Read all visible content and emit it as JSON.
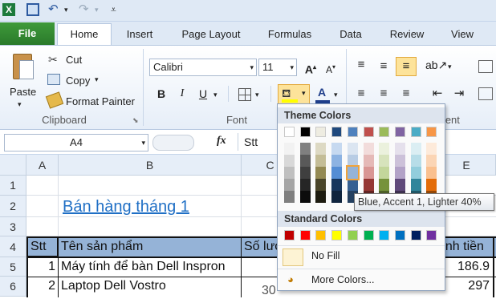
{
  "qat": {
    "app_icon": "excel-icon",
    "icons": [
      "save-icon",
      "undo-icon",
      "redo-icon",
      "customize-qat-icon"
    ]
  },
  "tabs": [
    "File",
    "Home",
    "Insert",
    "Page Layout",
    "Formulas",
    "Data",
    "Review",
    "View"
  ],
  "clipboard": {
    "paste": "Paste",
    "cut": "Cut",
    "copy": "Copy",
    "format_painter": "Format Painter",
    "group": "Clipboard"
  },
  "font": {
    "name": "Calibri",
    "size": "11",
    "group": "Font",
    "bold": "B",
    "italic": "I",
    "underline": "U"
  },
  "alignment": {
    "group": "Alignment"
  },
  "formula_bar": {
    "name_box": "A4",
    "fx": "fx",
    "value": "Stt"
  },
  "columns": [
    "A",
    "B",
    "C",
    "D",
    "E"
  ],
  "rows": [
    "1",
    "2",
    "3",
    "4",
    "5",
    "6"
  ],
  "sheet": {
    "title": "Bán hàng tháng 1",
    "header": {
      "stt": "Stt",
      "product": "Tên sản phẩm",
      "qty": "Số lượ",
      "total": "ành tiền"
    },
    "rows": [
      {
        "stt": "1",
        "product": "Máy tính để bàn Dell Inspron",
        "total": "186.9"
      },
      {
        "stt": "2",
        "product": "Laptop Dell Vostro",
        "qty": "30",
        "total": "297"
      }
    ]
  },
  "color_menu": {
    "theme_title": "Theme Colors",
    "standard_title": "Standard Colors",
    "no_fill": "No Fill",
    "more_colors": "More Colors...",
    "tooltip": "Blue, Accent 1, Lighter 40%",
    "theme_base": [
      "#ffffff",
      "#000000",
      "#eeece1",
      "#1f497d",
      "#4f81bd",
      "#c0504d",
      "#9bbb59",
      "#8064a2",
      "#4bacc6",
      "#f79646"
    ],
    "theme_shades": [
      [
        "#f2f2f2",
        "#d8d8d8",
        "#bfbfbf",
        "#a5a5a5",
        "#7f7f7f"
      ],
      [
        "#7f7f7f",
        "#595959",
        "#3f3f3f",
        "#262626",
        "#0c0c0c"
      ],
      [
        "#ddd9c3",
        "#c4bd97",
        "#938953",
        "#494429",
        "#1d1b10"
      ],
      [
        "#c6d9f0",
        "#8db3e2",
        "#548dd4",
        "#17365d",
        "#0f243e"
      ],
      [
        "#dbe5f1",
        "#b8cce4",
        "#95b3d7",
        "#366092",
        "#244061"
      ],
      [
        "#f2dcdb",
        "#e5b9b7",
        "#d99694",
        "#953734",
        "#632423"
      ],
      [
        "#ebf1dd",
        "#d7e3bc",
        "#c3d69b",
        "#76923c",
        "#4f6128"
      ],
      [
        "#e5e0ec",
        "#ccc1d9",
        "#b2a2c7",
        "#5f497a",
        "#3f3151"
      ],
      [
        "#dbeef3",
        "#b7dde8",
        "#92cddc",
        "#31859b",
        "#205867"
      ],
      [
        "#fdeada",
        "#fbd5b5",
        "#fac08f",
        "#e36c09",
        "#974806"
      ]
    ],
    "standard": [
      "#c00000",
      "#ff0000",
      "#ffc000",
      "#ffff00",
      "#92d050",
      "#00b050",
      "#00b0f0",
      "#0070c0",
      "#002060",
      "#7030a0"
    ],
    "selected": "Blue, Accent 1, Lighter 40%"
  },
  "colors": {
    "accent_green": "#2a7a2b",
    "header_fill": "#95b3d7",
    "title_link": "#1f6fc5"
  }
}
